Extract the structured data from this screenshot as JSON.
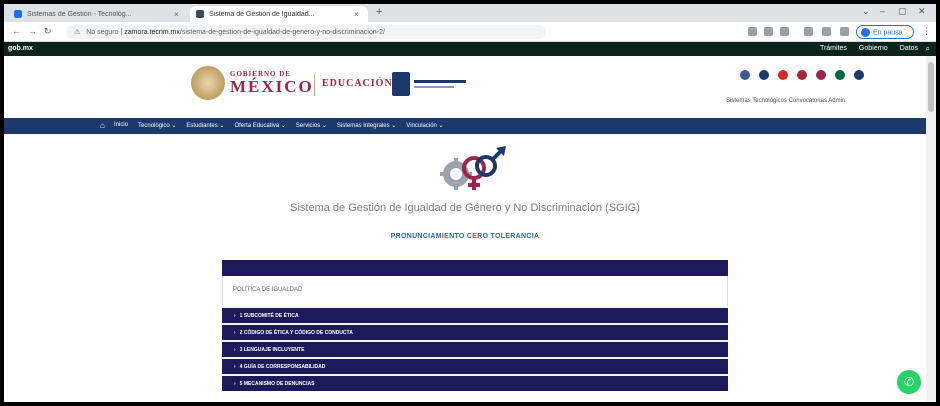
{
  "browser": {
    "tabs": [
      {
        "label": "Sistemas de Gestión - Tecnológ...",
        "active": false
      },
      {
        "label": "Sistema de Gestión de Igualdad...",
        "active": true
      }
    ],
    "new_tab": "+",
    "url_warning": "No seguro",
    "url_host": "zamora.tecnm.mx",
    "url_path": "/sistema-de-gestion-de-igualdad-de-genero-y-no-discriminacion-2/",
    "profile_label": "En pausa"
  },
  "gob_bar": {
    "brand": "gob.mx",
    "links": [
      "Trámites",
      "Gobierno",
      "Datos"
    ]
  },
  "header": {
    "gob_small": "GOBIERNO DE",
    "gob_big": "MÉXICO",
    "edu": "EDUCACIÓN",
    "links": "Sistemas Tecnológicos   Convocatorias   Admin"
  },
  "nav": {
    "items": [
      "Inicio",
      "Tecnológico ⌄",
      "Estudiantes ⌄",
      "Oferta Educativa ⌄",
      "Servicios ⌄",
      "Sistemas Integrales ⌄",
      "Vinculación ⌄"
    ]
  },
  "page": {
    "title": "Sistema de Gestión de Igualdad de Género y No Discriminación (SGIG)",
    "subtitle": "PRONUNCIAMIENTO CERO TOLERANCIA",
    "panel_body": "POLÍTICA DE IGUALDAD",
    "accordion": [
      "1 SUBCOMITÉ DE ÉTICA",
      "2 CÓDIGO DE ÉTICA Y CÓDIGO DE CONDUCTA",
      "3 LENGUAJE INCLUYENTE",
      "4 GUÍA DE CORRESPONSABILIDAD",
      "5 MECANISMO DE DENUNCIAS"
    ]
  },
  "colors": {
    "gob_dark": "#0b231e",
    "nav_blue": "#1b396a",
    "guinda": "#9d2449",
    "accordion": "#1d1a5c",
    "whatsapp": "#25d366"
  }
}
